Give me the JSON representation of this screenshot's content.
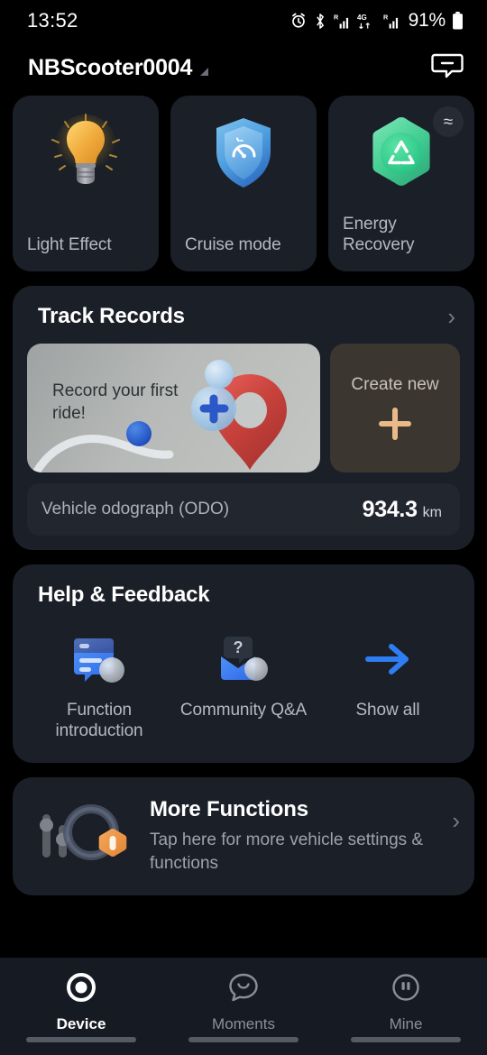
{
  "status_bar": {
    "time": "13:52",
    "battery_percent": "91%",
    "icons": [
      "alarm-icon",
      "bluetooth-icon",
      "signal-roaming-icon",
      "network-4g-icon",
      "signal-roaming-2-icon",
      "battery-icon"
    ]
  },
  "header": {
    "device_name": "NBScooter0004",
    "dropdown_caret": "caret-down-icon",
    "message_icon": "message-bubble-icon"
  },
  "quick_actions": [
    {
      "label": "Light Effect",
      "icon": "lightbulb-icon"
    },
    {
      "label": "Cruise mode",
      "icon": "shield-speedometer-icon"
    },
    {
      "label": "Energy Recovery",
      "icon": "recycle-hexagon-icon",
      "badge": "≈"
    }
  ],
  "track_records": {
    "title": "Track Records",
    "chevron": "›",
    "promo": {
      "text": "Record your first ride!",
      "art": "map-pin-illustration"
    },
    "create": {
      "label": "Create new",
      "icon": "plus-icon"
    },
    "odometer": {
      "label": "Vehicle odograph (ODO)",
      "value": "934.3",
      "unit": "km"
    }
  },
  "help_feedback": {
    "title": "Help & Feedback",
    "items": [
      {
        "label": "Function introduction",
        "icon": "document-chat-icon"
      },
      {
        "label": "Community Q&A",
        "icon": "mailbox-question-icon"
      },
      {
        "label": "Show all",
        "icon": "arrow-right-icon"
      }
    ]
  },
  "more_functions": {
    "title": "More Functions",
    "subtitle": "Tap here for more vehicle settings & functions",
    "icon": "sliders-gauge-icon",
    "chevron": "›"
  },
  "bottom_nav": [
    {
      "label": "Device",
      "icon": "device-ring-icon",
      "active": true
    },
    {
      "label": "Moments",
      "icon": "smiley-bubble-icon",
      "active": false
    },
    {
      "label": "Mine",
      "icon": "profile-circle-icon",
      "active": false
    }
  ],
  "colors": {
    "background": "#000000",
    "card": "#1b1f28",
    "accent_blue": "#3b82f6",
    "accent_green": "#3ddc97",
    "accent_orange": "#eab98a",
    "nav_background": "#161a23"
  }
}
